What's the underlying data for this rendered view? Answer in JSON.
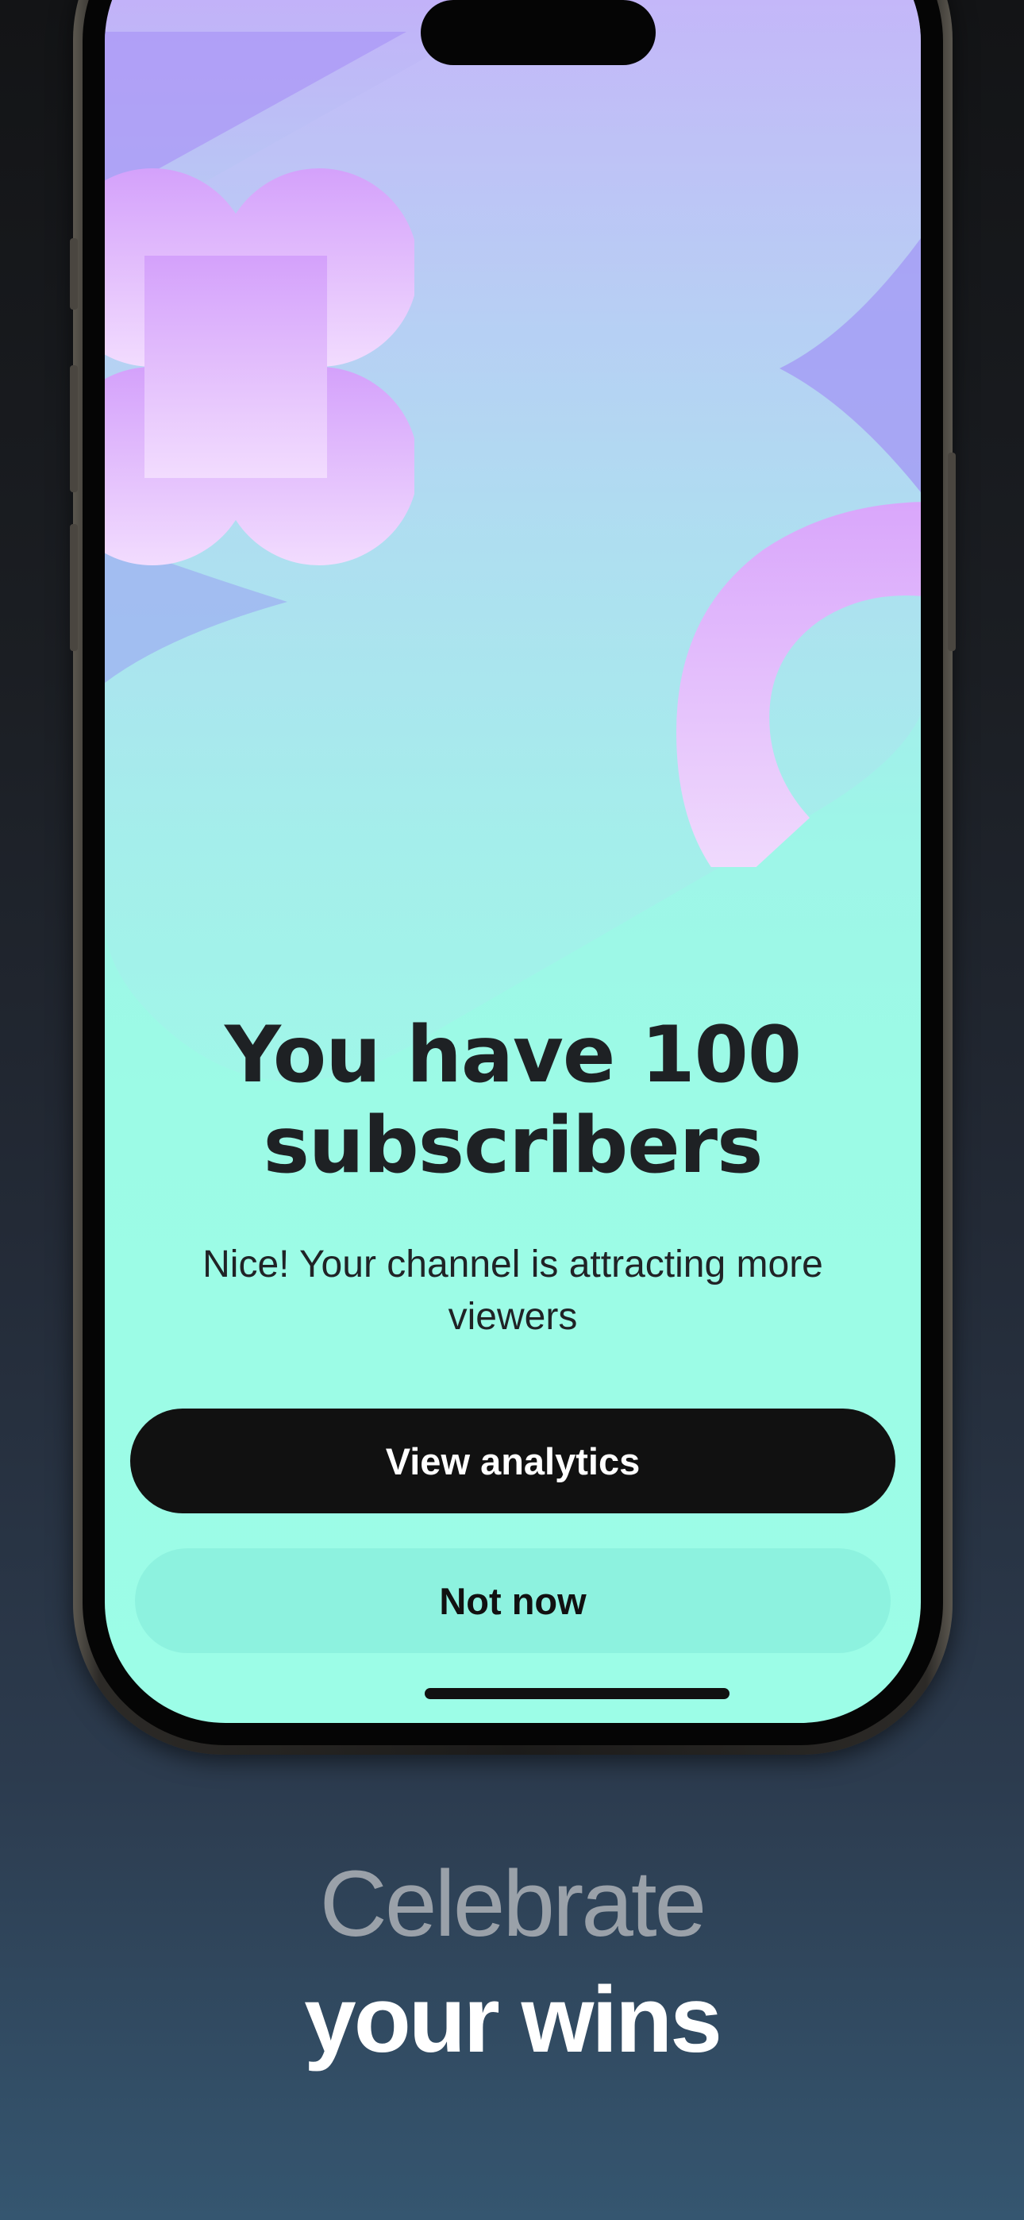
{
  "celebration": {
    "headline_line1": "You have 100",
    "headline_line2": "subscribers",
    "message": "Nice! Your channel is attracting more viewers",
    "primary_action": "View analytics",
    "secondary_action": "Not now"
  },
  "promo": {
    "caption_line1": "Celebrate",
    "caption_line2": "your wins"
  },
  "colors": {
    "primary_button": "#111111",
    "secondary_button": "#8df2df",
    "screen_top": "#c6a9fb",
    "screen_bottom": "#9cfde7"
  },
  "icons": {
    "decorations": [
      "plus-cross-shape",
      "star-shape",
      "arc-shape"
    ]
  }
}
